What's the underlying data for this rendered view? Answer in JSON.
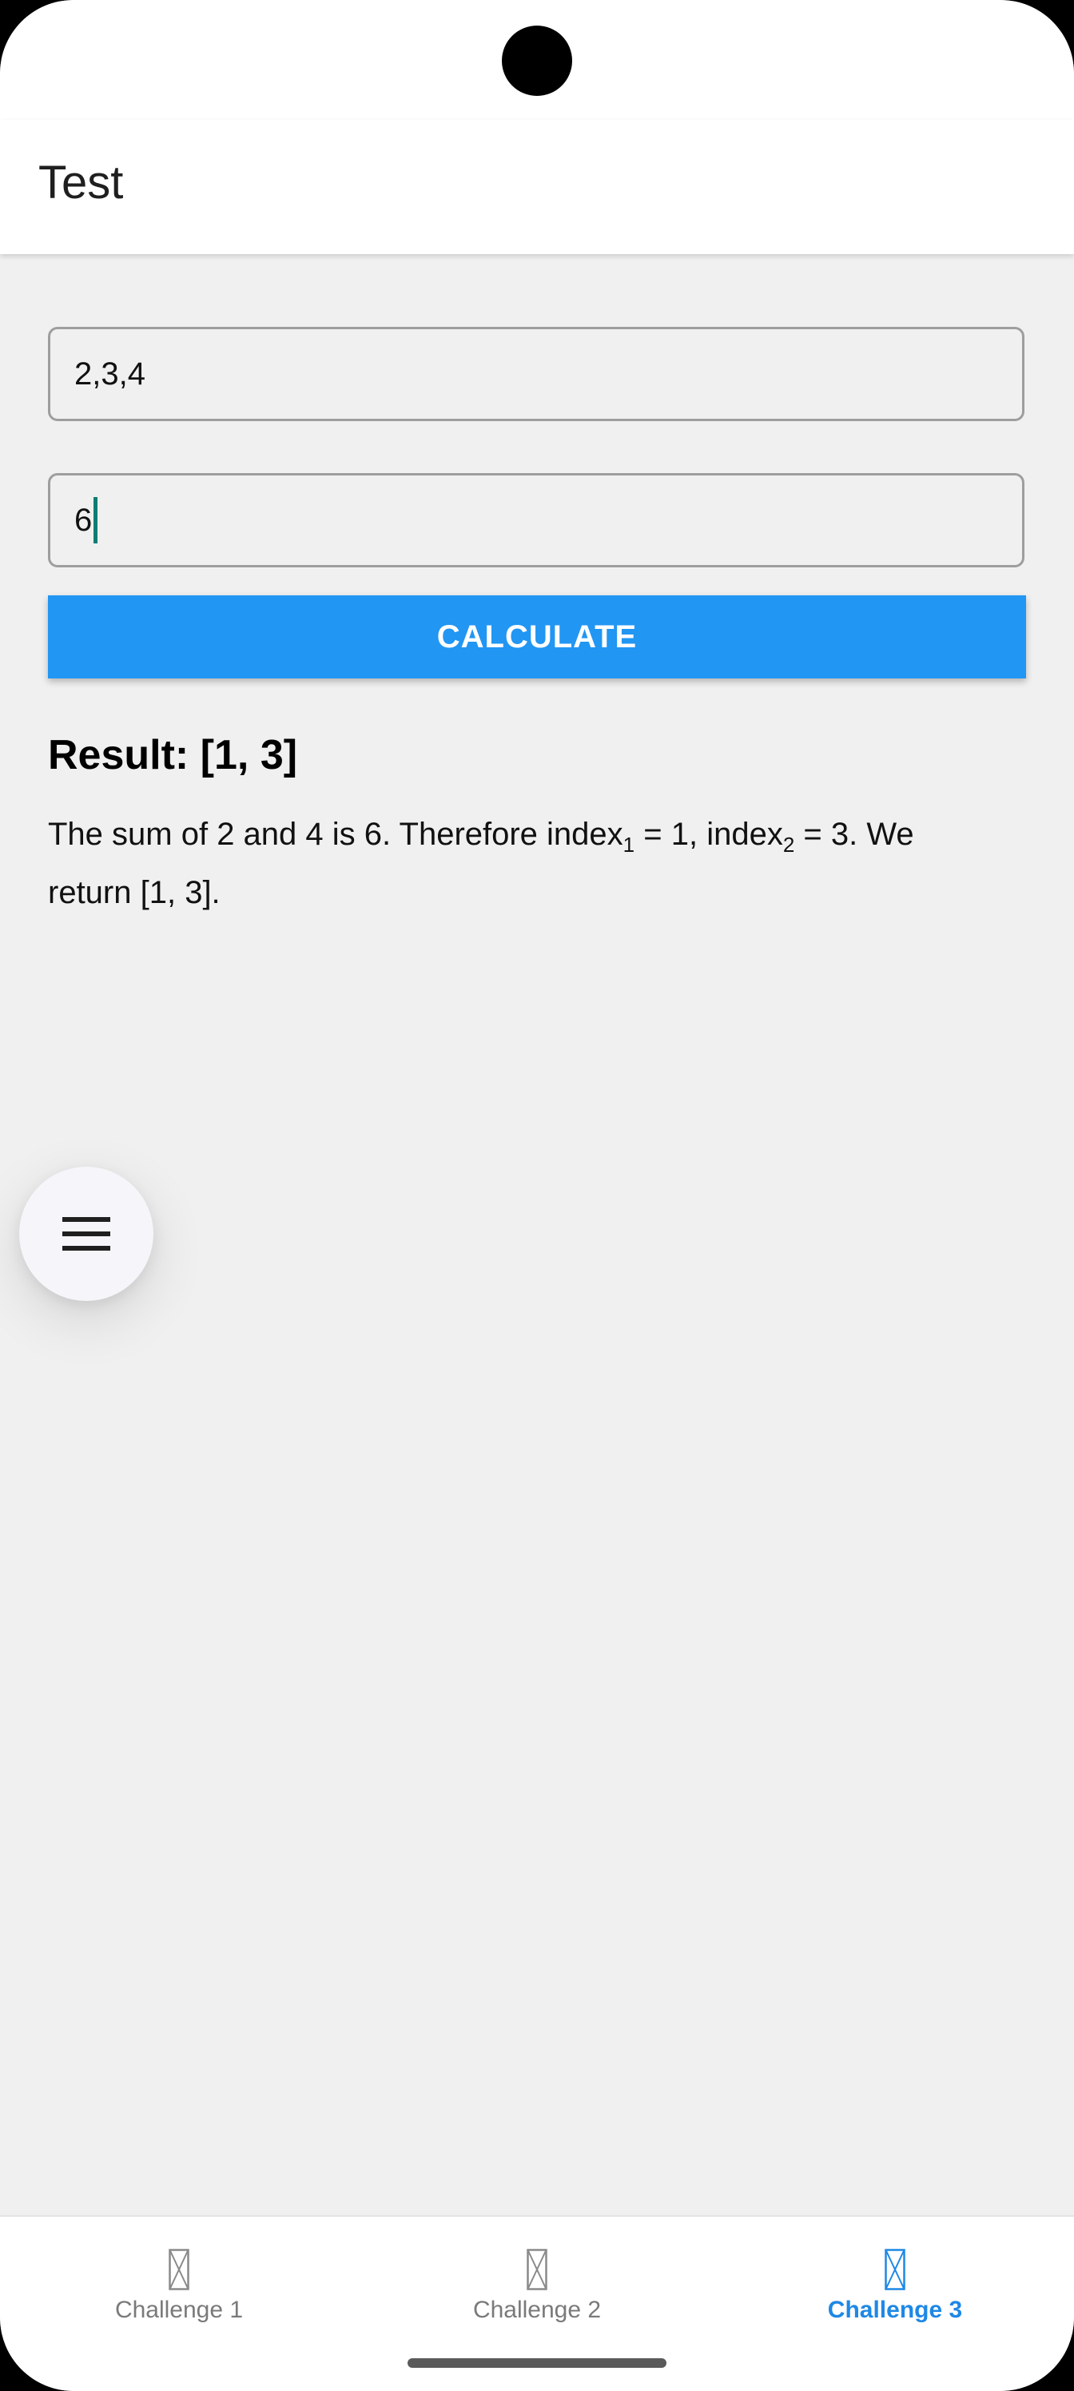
{
  "app_bar": {
    "title": "Test"
  },
  "inputs": {
    "numbers_value": "2,3,4",
    "target_value": "6"
  },
  "actions": {
    "calculate_label": "CALCULATE"
  },
  "result": {
    "title": "Result: [1, 3]",
    "text_part1": "The sum of 2 and 4 is 6. Therefore index",
    "sub1": "1",
    "text_part2": " = 1, index",
    "sub2": "2",
    "text_part3": " = 3. We return [1, 3]."
  },
  "fab": {
    "icon": "menu-icon"
  },
  "bottom_nav": {
    "items": [
      {
        "label": "Challenge 1",
        "icon": "broken-image-icon",
        "active": false
      },
      {
        "label": "Challenge 2",
        "icon": "broken-image-icon",
        "active": false
      },
      {
        "label": "Challenge 3",
        "icon": "broken-image-icon",
        "active": true
      }
    ]
  },
  "colors": {
    "accent": "#2196f3",
    "active_tab": "#1e88e5",
    "cursor": "#0b7d73",
    "background": "#f0f0f0"
  }
}
